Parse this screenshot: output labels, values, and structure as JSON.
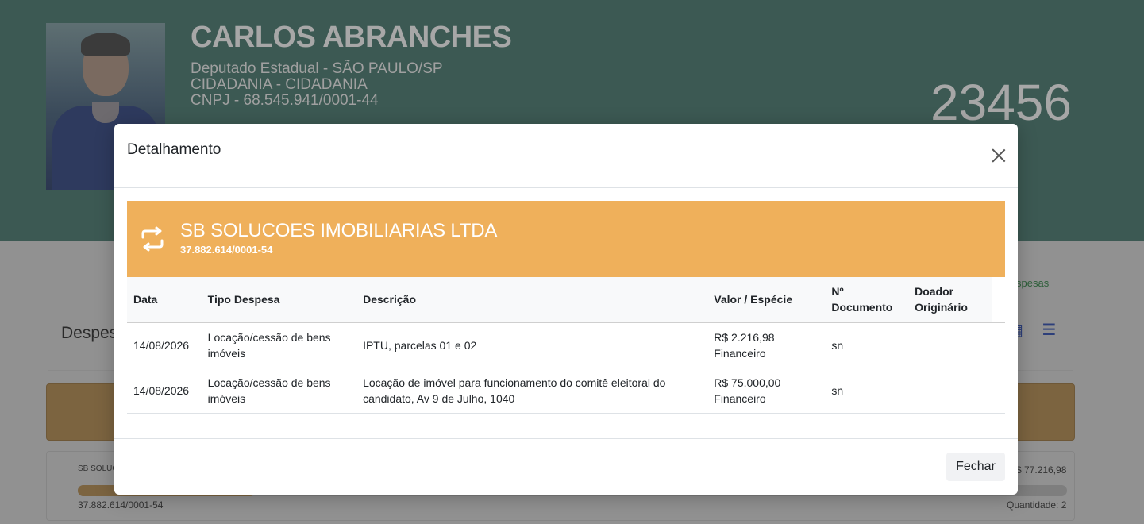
{
  "candidate": {
    "name": "CARLOS ABRANCHES",
    "role": "Deputado Estadual - SÃO PAULO/SP",
    "party": "CIDADANIA - CIDADANIA",
    "cnpj": "CNPJ - 68.545.941/0001-44",
    "number": "23456"
  },
  "background": {
    "link_fragment": "spesas",
    "section_title_fragment": "Despes",
    "card": {
      "name_fragment": "SB SOLUC",
      "cnpj": "37.882.614/0001-54",
      "total_fragment": "$ 77.216,98",
      "quantity": "Quantidade: 2",
      "progress_fraction": 0.18
    }
  },
  "modal": {
    "title": "Detalhamento",
    "vendor": {
      "name": "SB SOLUCOES IMOBILIARIAS LTDA",
      "cnpj": "37.882.614/0001-54",
      "icon": "repeat-icon"
    },
    "table": {
      "headers": {
        "data": "Data",
        "tipo": "Tipo Despesa",
        "descricao": "Descrição",
        "valor": "Valor / Espécie",
        "documento_line1": "Nº",
        "documento_line2": "Documento",
        "doador_line1": "Doador",
        "doador_line2": "Originário"
      },
      "rows": [
        {
          "data": "14/08/2026",
          "tipo_line1": "Locação/cessão de bens",
          "tipo_line2": "imóveis",
          "descricao_line1": "IPTU, parcelas 01 e 02",
          "descricao_line2": "",
          "valor": "R$ 2.216,98",
          "especie": "Financeiro",
          "documento": "sn",
          "doador": ""
        },
        {
          "data": "14/08/2026",
          "tipo_line1": "Locação/cessão de bens",
          "tipo_line2": "imóveis",
          "descricao_line1": "Locação de imóvel para funcionamento do comitê eleitoral do",
          "descricao_line2": "candidato, Av 9 de Julho, 1040",
          "valor": "R$ 75.000,00",
          "especie": "Financeiro",
          "documento": "sn",
          "doador": ""
        }
      ]
    },
    "close_button": "Fechar"
  },
  "colors": {
    "header_bg": "#3c5953",
    "banner_orange": "#efb05b",
    "overlay_gray": "#919191"
  }
}
